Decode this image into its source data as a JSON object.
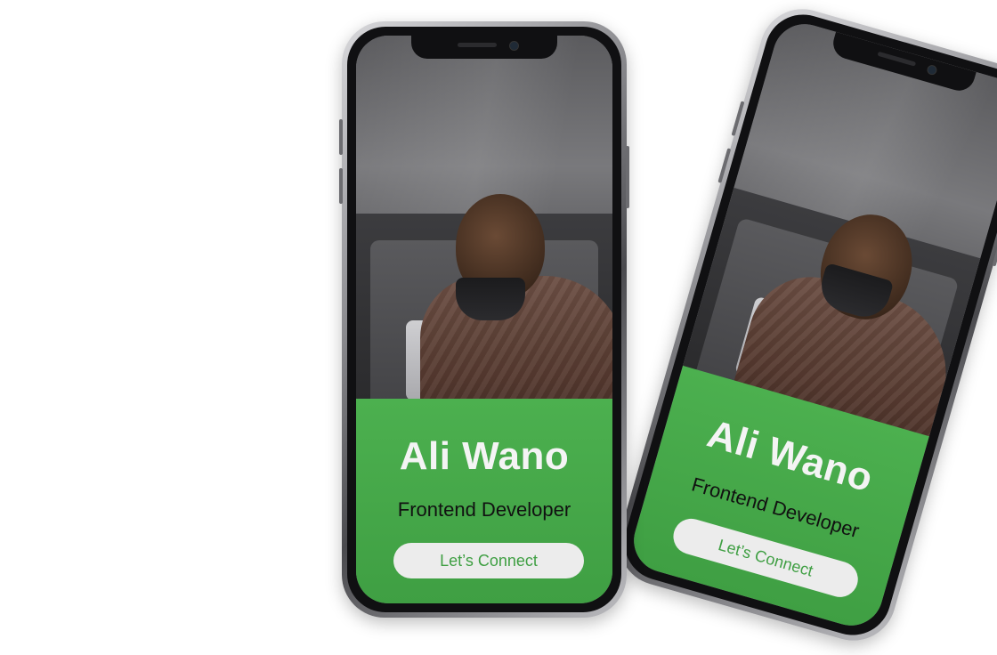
{
  "profile": {
    "name": "Ali Wano",
    "role": "Frontend Developer",
    "cta_label": "Let’s Connect"
  },
  "colors": {
    "accent_green": "#4cb04f",
    "button_bg": "#ececec",
    "button_text": "#3f9f43"
  }
}
